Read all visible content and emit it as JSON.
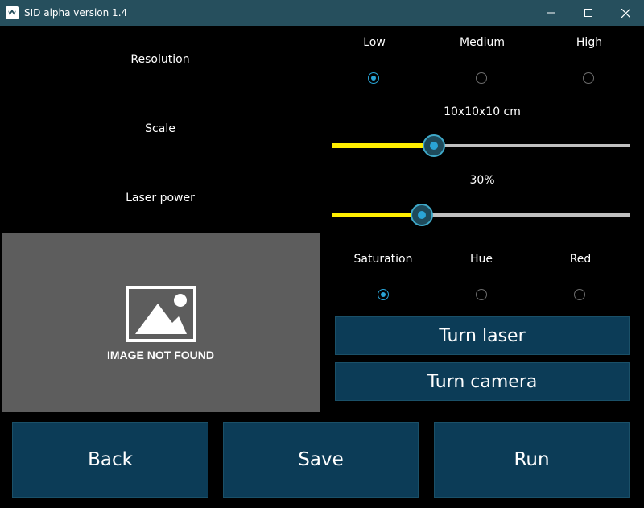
{
  "window": {
    "title": "SID alpha version 1.4"
  },
  "settings": {
    "resolution": {
      "label": "Resolution",
      "options": [
        {
          "label": "Low",
          "checked": true
        },
        {
          "label": "Medium",
          "checked": false
        },
        {
          "label": "High",
          "checked": false
        }
      ]
    },
    "scale": {
      "label": "Scale",
      "value_text": "10x10x10 cm",
      "fraction": 0.34
    },
    "laser_power": {
      "label": "Laser power",
      "value_text": "30%",
      "fraction": 0.3
    },
    "channel": {
      "options": [
        {
          "label": "Saturation",
          "checked": true
        },
        {
          "label": "Hue",
          "checked": false
        },
        {
          "label": "Red",
          "checked": false
        }
      ]
    }
  },
  "image": {
    "not_found_text": "IMAGE NOT FOUND"
  },
  "buttons": {
    "turn_laser": "Turn laser",
    "turn_camera": "Turn camera",
    "back": "Back",
    "save": "Save",
    "run": "Run"
  },
  "colors": {
    "titlebar": "#264f5d",
    "button_bg": "#0c3c57",
    "slider_fill": "#ffee00",
    "radio_accent": "#2aa4d6"
  },
  "icons": {
    "app": "app-logo-icon",
    "minimize": "minimize-icon",
    "maximize": "maximize-icon",
    "close": "close-icon",
    "image_placeholder": "image-placeholder-icon"
  }
}
